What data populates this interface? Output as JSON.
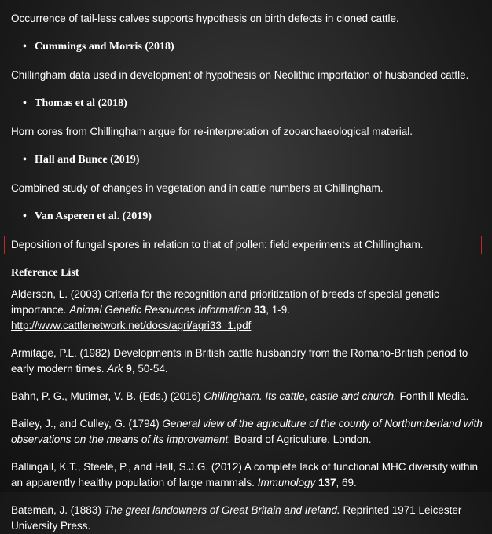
{
  "entries": [
    {
      "desc": "Occurrence of tail-less calves supports hypothesis on birth defects in cloned cattle."
    },
    {
      "author": "Cummings and Morris (2018)",
      "desc": "Chillingham data used in development of hypothesis on Neolithic importation of husbanded cattle."
    },
    {
      "author": "Thomas et al (2018)",
      "desc": "Horn cores from Chillingham argue for re-interpretation of zooarchaeological material."
    },
    {
      "author": "Hall and Bunce (2019)",
      "desc": "Combined study of changes in vegetation and in cattle numbers at Chillingham."
    },
    {
      "author": "Van Asperen et al. (2019)",
      "desc": "Deposition of fungal spores in relation to that of pollen: field experiments at Chillingham."
    }
  ],
  "reference_heading": "Reference List",
  "references": [
    {
      "plain1": "Alderson, L. (2003) Criteria for the recognition and prioritization of breeds of special genetic importance. ",
      "italic": "Animal Genetic Resources Information",
      "bold": " 33",
      "plain2": ", 1-9. ",
      "link": "http://www.cattlenetwork.net/docs/agri/agri33_1.pdf"
    },
    {
      "plain1": "Armitage, P.L. (1982) Developments in British cattle husbandry from the Romano-British period to early modern times. ",
      "italic": "Ark",
      "bold": " 9",
      "plain2": ", 50-54."
    },
    {
      "plain1": "Bahn, P. G., Mutimer, V. B. (Eds.) (2016) ",
      "italic": "Chillingham. Its cattle, castle and church.",
      "plain2": " Fonthill Media."
    },
    {
      "plain1": "Bailey, J., and Culley, G. (1794) ",
      "italic": "General view of the agriculture of the county of Northumberland with observations on the means of its improvement.",
      "plain2": " Board of Agriculture, London."
    },
    {
      "plain1": "Ballingall, K.T., Steele, P., and Hall, S.J.G. (2012) A complete lack of functional MHC diversity within an apparently healthy population of large mammals. ",
      "italic": "Immunology",
      "bold": " 137",
      "plain2": ", 69."
    },
    {
      "plain1": "Bateman, J. (1883) ",
      "italic": "The great landowners of Great Britain and Ireland.",
      "plain2": " Reprinted 1971 Leicester University Press."
    }
  ]
}
